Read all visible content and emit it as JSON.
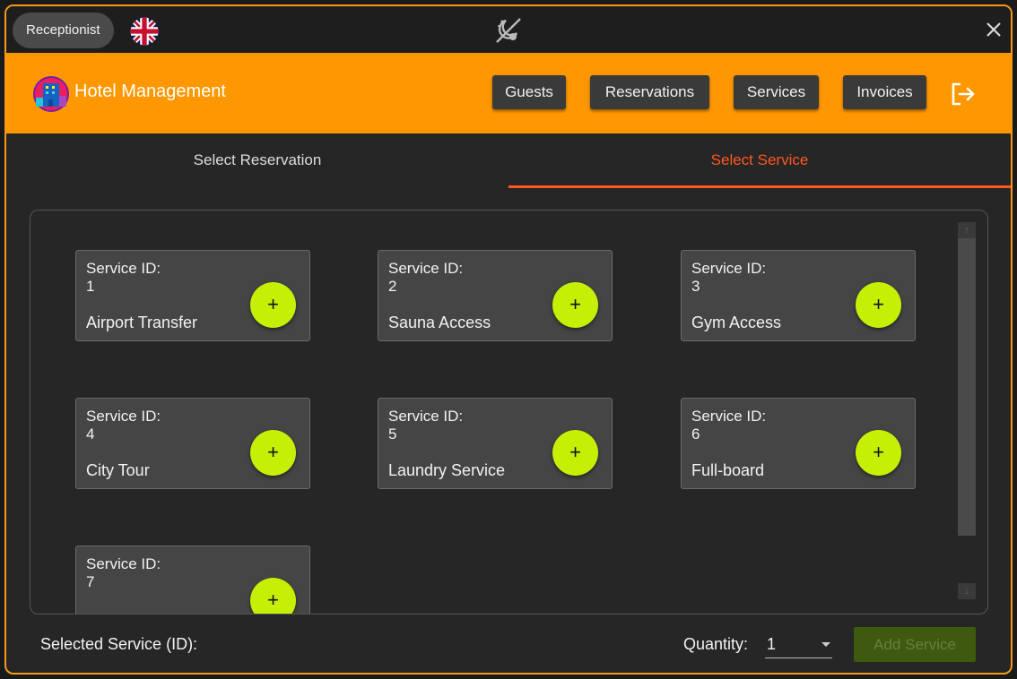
{
  "titlebar": {
    "role_badge": "Receptionist",
    "flag_icon": "uk-flag-icon",
    "theme_icon": "day-night-toggle-icon",
    "close_icon": "close-icon"
  },
  "header": {
    "app_title": "Hotel Management",
    "logo_icon": "hotel-logo-icon",
    "nav": [
      "Guests",
      "Reservations",
      "Services",
      "Invoices"
    ],
    "logout_icon": "logout-icon"
  },
  "tabs": {
    "items": [
      "Select Reservation",
      "Select Service"
    ],
    "active": "Select Service"
  },
  "services": [
    {
      "id_label": "Service ID:",
      "id": "1",
      "name": "Airport Transfer"
    },
    {
      "id_label": "Service ID:",
      "id": "2",
      "name": "Sauna Access"
    },
    {
      "id_label": "Service ID:",
      "id": "3",
      "name": "Gym Access"
    },
    {
      "id_label": "Service ID:",
      "id": "4",
      "name": "City Tour"
    },
    {
      "id_label": "Service ID:",
      "id": "5",
      "name": "Laundry Service"
    },
    {
      "id_label": "Service ID:",
      "id": "6",
      "name": "Full-board"
    },
    {
      "id_label": "Service ID:",
      "id": "7",
      "name": ""
    }
  ],
  "add_button_label": "+",
  "footer": {
    "selected_label": "Selected Service (ID):",
    "quantity_label": "Quantity:",
    "quantity_value": "1",
    "submit_label": "Add Service"
  },
  "colors": {
    "accent_orange": "#ff9800",
    "active_tab": "#ff5722",
    "add_button": "#c5f005",
    "submit_disabled": "#3d5a0e"
  }
}
